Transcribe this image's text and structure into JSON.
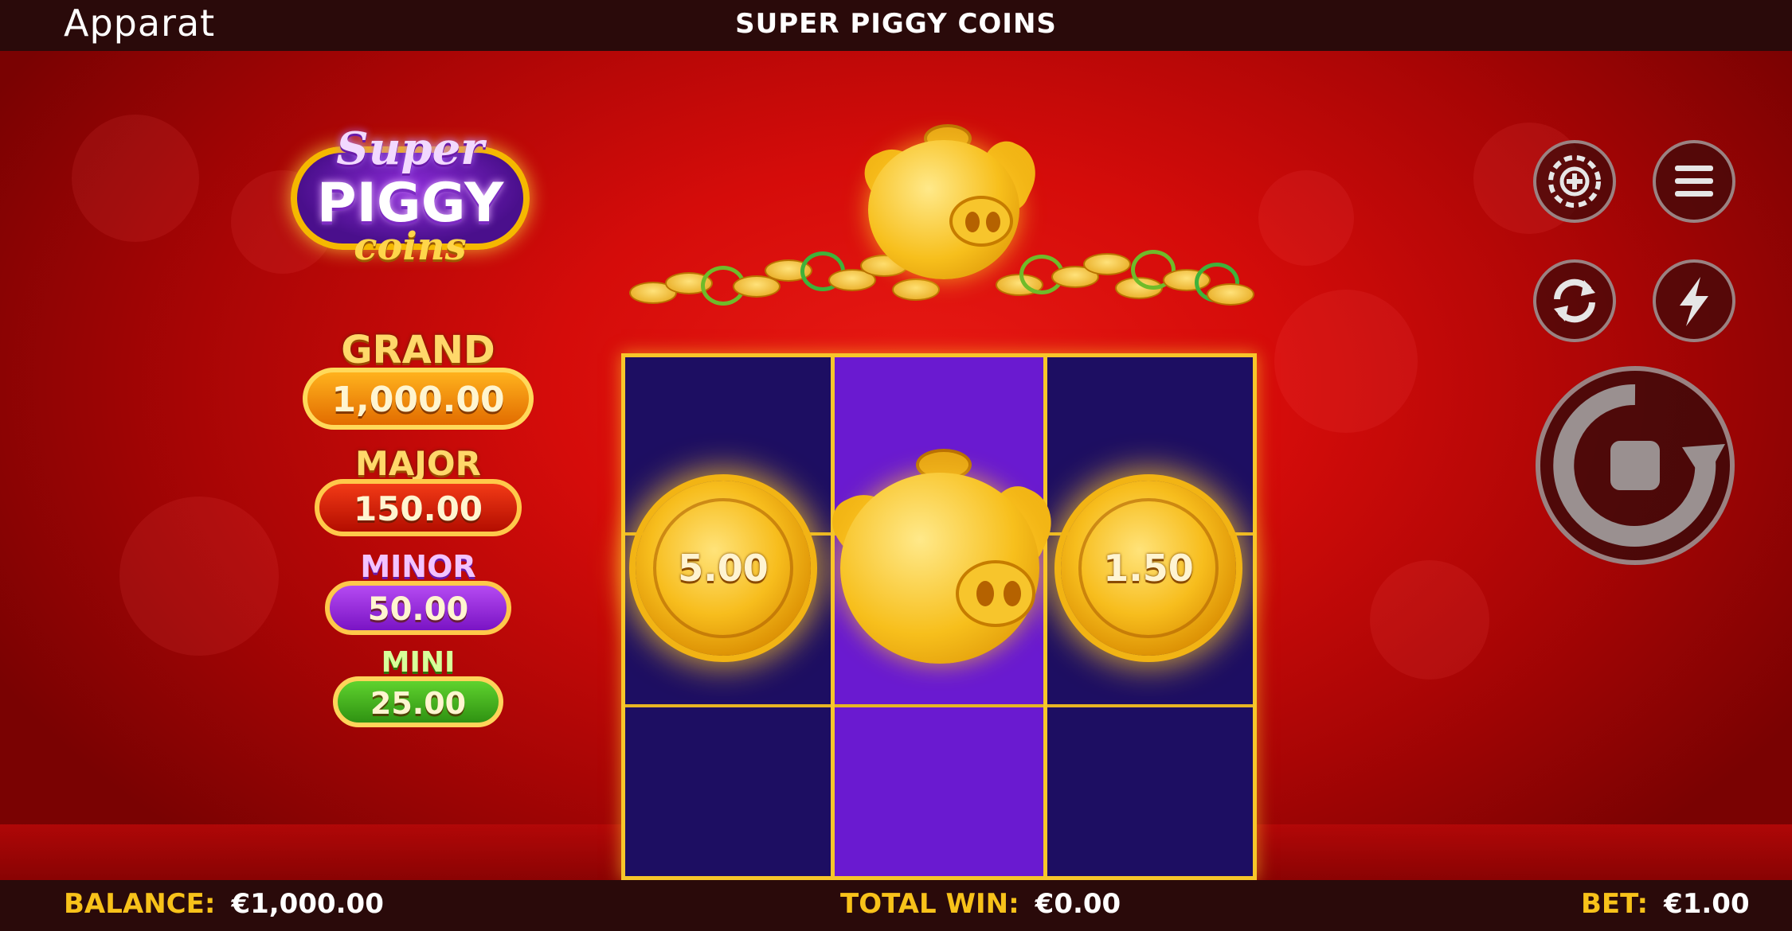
{
  "header": {
    "brand": "Apparat",
    "title": "SUPER PIGGY COINS"
  },
  "logo": {
    "line1": "Super",
    "line2": "PIGGY",
    "line3": "coins"
  },
  "jackpots": [
    {
      "name": "GRAND",
      "value": "1,000.00",
      "color": "#f08a00"
    },
    {
      "name": "MAJOR",
      "value": "150.00",
      "color": "#d81e0a"
    },
    {
      "name": "MINOR",
      "value": "50.00",
      "color": "#9a2be0"
    },
    {
      "name": "MINI",
      "value": "25.00",
      "color": "#3fae1c"
    }
  ],
  "reels": {
    "coins": [
      {
        "reel": 1,
        "row": 2,
        "value": "5.00"
      },
      {
        "reel": 3,
        "row": 2,
        "value": "1.50"
      }
    ]
  },
  "controls": {
    "chips_icon": "chip-plus-icon",
    "menu_icon": "hamburger-menu-icon",
    "autoplay_icon": "autoplay-arrows-icon",
    "turbo_icon": "lightning-bolt-icon",
    "spin_icon": "stop-spin-icon"
  },
  "footer": {
    "balance_label": "BALANCE:",
    "balance_value": "€1,000.00",
    "win_label": "TOTAL WIN:",
    "win_value": "€0.00",
    "bet_label": "BET:",
    "bet_value": "€1.00"
  },
  "colors": {
    "background": "#d50c0a",
    "reel_blue": "#1d0e62",
    "reel_purple": "#6a1ad0",
    "gold": "#f7c62a",
    "label_yellow": "#f8c21a"
  }
}
